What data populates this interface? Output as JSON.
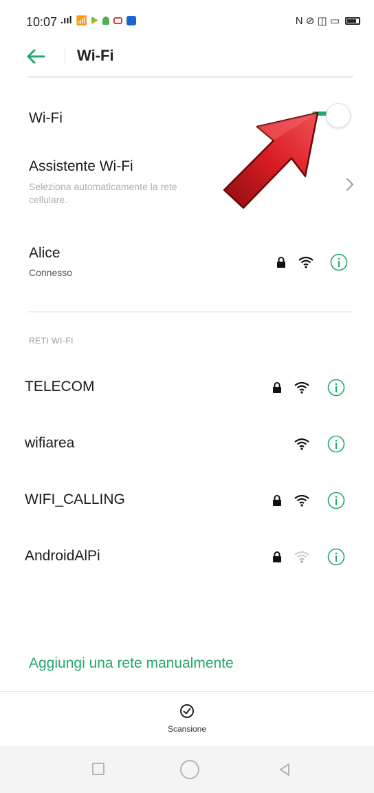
{
  "status_bar": {
    "time": "10:07",
    "signal_text": ".ııl",
    "right_text": "N ⊘ ◫ ▭"
  },
  "header": {
    "title": "Wi-Fi"
  },
  "wifi_toggle": {
    "label": "Wi-Fi",
    "state": "on"
  },
  "assistant": {
    "title": "Assistente Wi-Fi",
    "description_part1": "Seleziona automaticamente la rete",
    "description_part2": "rete",
    "description_line2": "cellulare."
  },
  "connected": {
    "name": "Alice",
    "status": "Connesso",
    "secured": true,
    "signal": "full"
  },
  "section_label": "RETI WI-FI",
  "networks": [
    {
      "name": "TELECOM",
      "secured": true,
      "signal": "full"
    },
    {
      "name": "wifiarea",
      "secured": false,
      "signal": "full"
    },
    {
      "name": "WIFI_CALLING",
      "secured": true,
      "signal": "full"
    },
    {
      "name": "AndroidAlPi",
      "secured": true,
      "signal": "weak"
    }
  ],
  "add_network_label": "Aggiungi una rete manualmente",
  "scan": {
    "label": "Scansione"
  },
  "colors": {
    "accent": "#22a96b",
    "arrow": "#c8151b",
    "muted_text": "#b0b0b0"
  }
}
